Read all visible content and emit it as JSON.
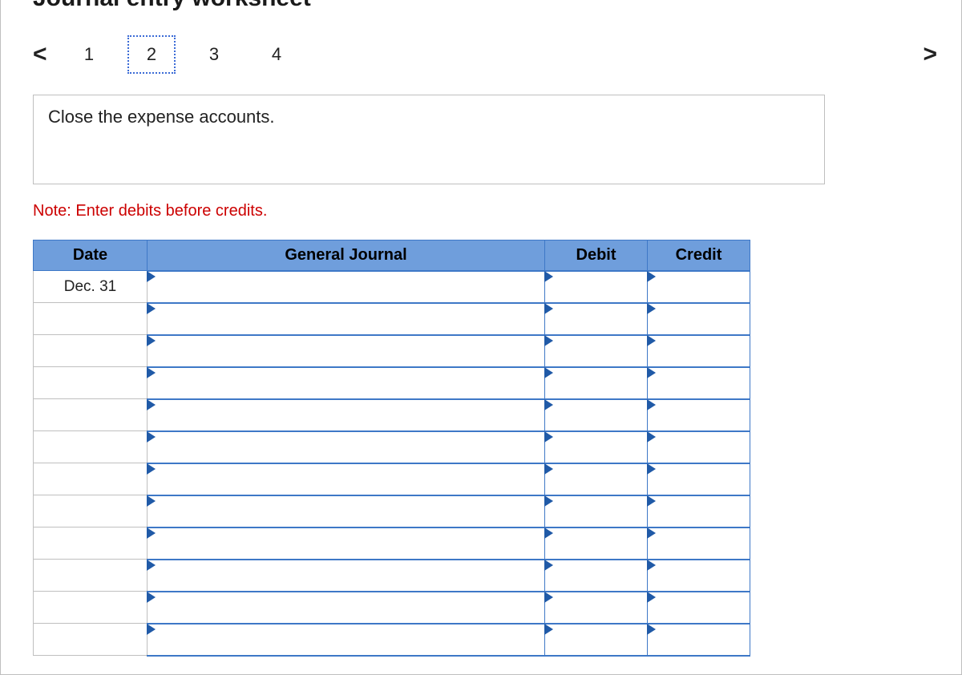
{
  "title": "Journal entry worksheet",
  "pager": {
    "prev_glyph": "<",
    "next_glyph": ">",
    "pages": [
      "1",
      "2",
      "3",
      "4"
    ],
    "active_index": 1
  },
  "instruction": "Close the expense accounts.",
  "note": "Note: Enter debits before credits.",
  "headers": {
    "date": "Date",
    "gj": "General Journal",
    "debit": "Debit",
    "credit": "Credit"
  },
  "rows": [
    {
      "date": "Dec. 31",
      "gj": "",
      "debit": "",
      "credit": ""
    },
    {
      "date": "",
      "gj": "",
      "debit": "",
      "credit": ""
    },
    {
      "date": "",
      "gj": "",
      "debit": "",
      "credit": ""
    },
    {
      "date": "",
      "gj": "",
      "debit": "",
      "credit": ""
    },
    {
      "date": "",
      "gj": "",
      "debit": "",
      "credit": ""
    },
    {
      "date": "",
      "gj": "",
      "debit": "",
      "credit": ""
    },
    {
      "date": "",
      "gj": "",
      "debit": "",
      "credit": ""
    },
    {
      "date": "",
      "gj": "",
      "debit": "",
      "credit": ""
    },
    {
      "date": "",
      "gj": "",
      "debit": "",
      "credit": ""
    },
    {
      "date": "",
      "gj": "",
      "debit": "",
      "credit": ""
    },
    {
      "date": "",
      "gj": "",
      "debit": "",
      "credit": ""
    },
    {
      "date": "",
      "gj": "",
      "debit": "",
      "credit": ""
    }
  ]
}
